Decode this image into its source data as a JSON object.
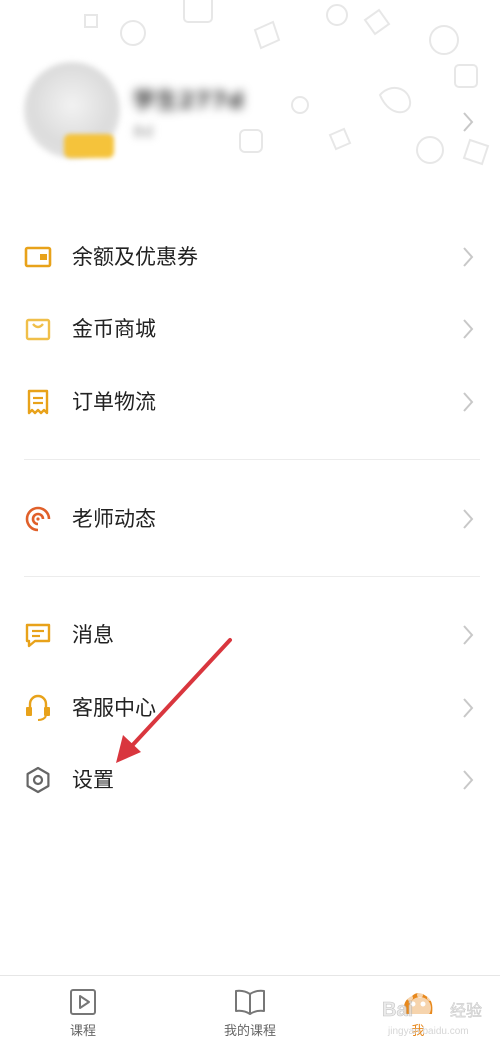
{
  "profile": {
    "username": "学生277d",
    "subtitle": "8d"
  },
  "menu": {
    "balance": "余额及优惠券",
    "coin_mall": "金币商城",
    "orders": "订单物流",
    "teacher_news": "老师动态",
    "messages": "消息",
    "customer_service": "客服中心",
    "settings": "设置"
  },
  "tabbar": {
    "courses": "课程",
    "my_courses": "我的课程",
    "me": "我"
  },
  "watermark": {
    "brand": "Bai",
    "brand_cn": "经验",
    "url": "jingyan.baidu.com"
  },
  "colors": {
    "accent": "#e8a21a",
    "teacher_icon": "#e0602a",
    "arrow": "#d9363e",
    "settings_icon": "#666666"
  },
  "icons": {
    "balance": "wallet-icon",
    "coin_mall": "shopping-bag-icon",
    "orders": "receipt-icon",
    "teacher_news": "spiral-icon",
    "messages": "chat-bubble-icon",
    "customer_service": "headset-icon",
    "settings": "hexagon-gear-icon"
  }
}
